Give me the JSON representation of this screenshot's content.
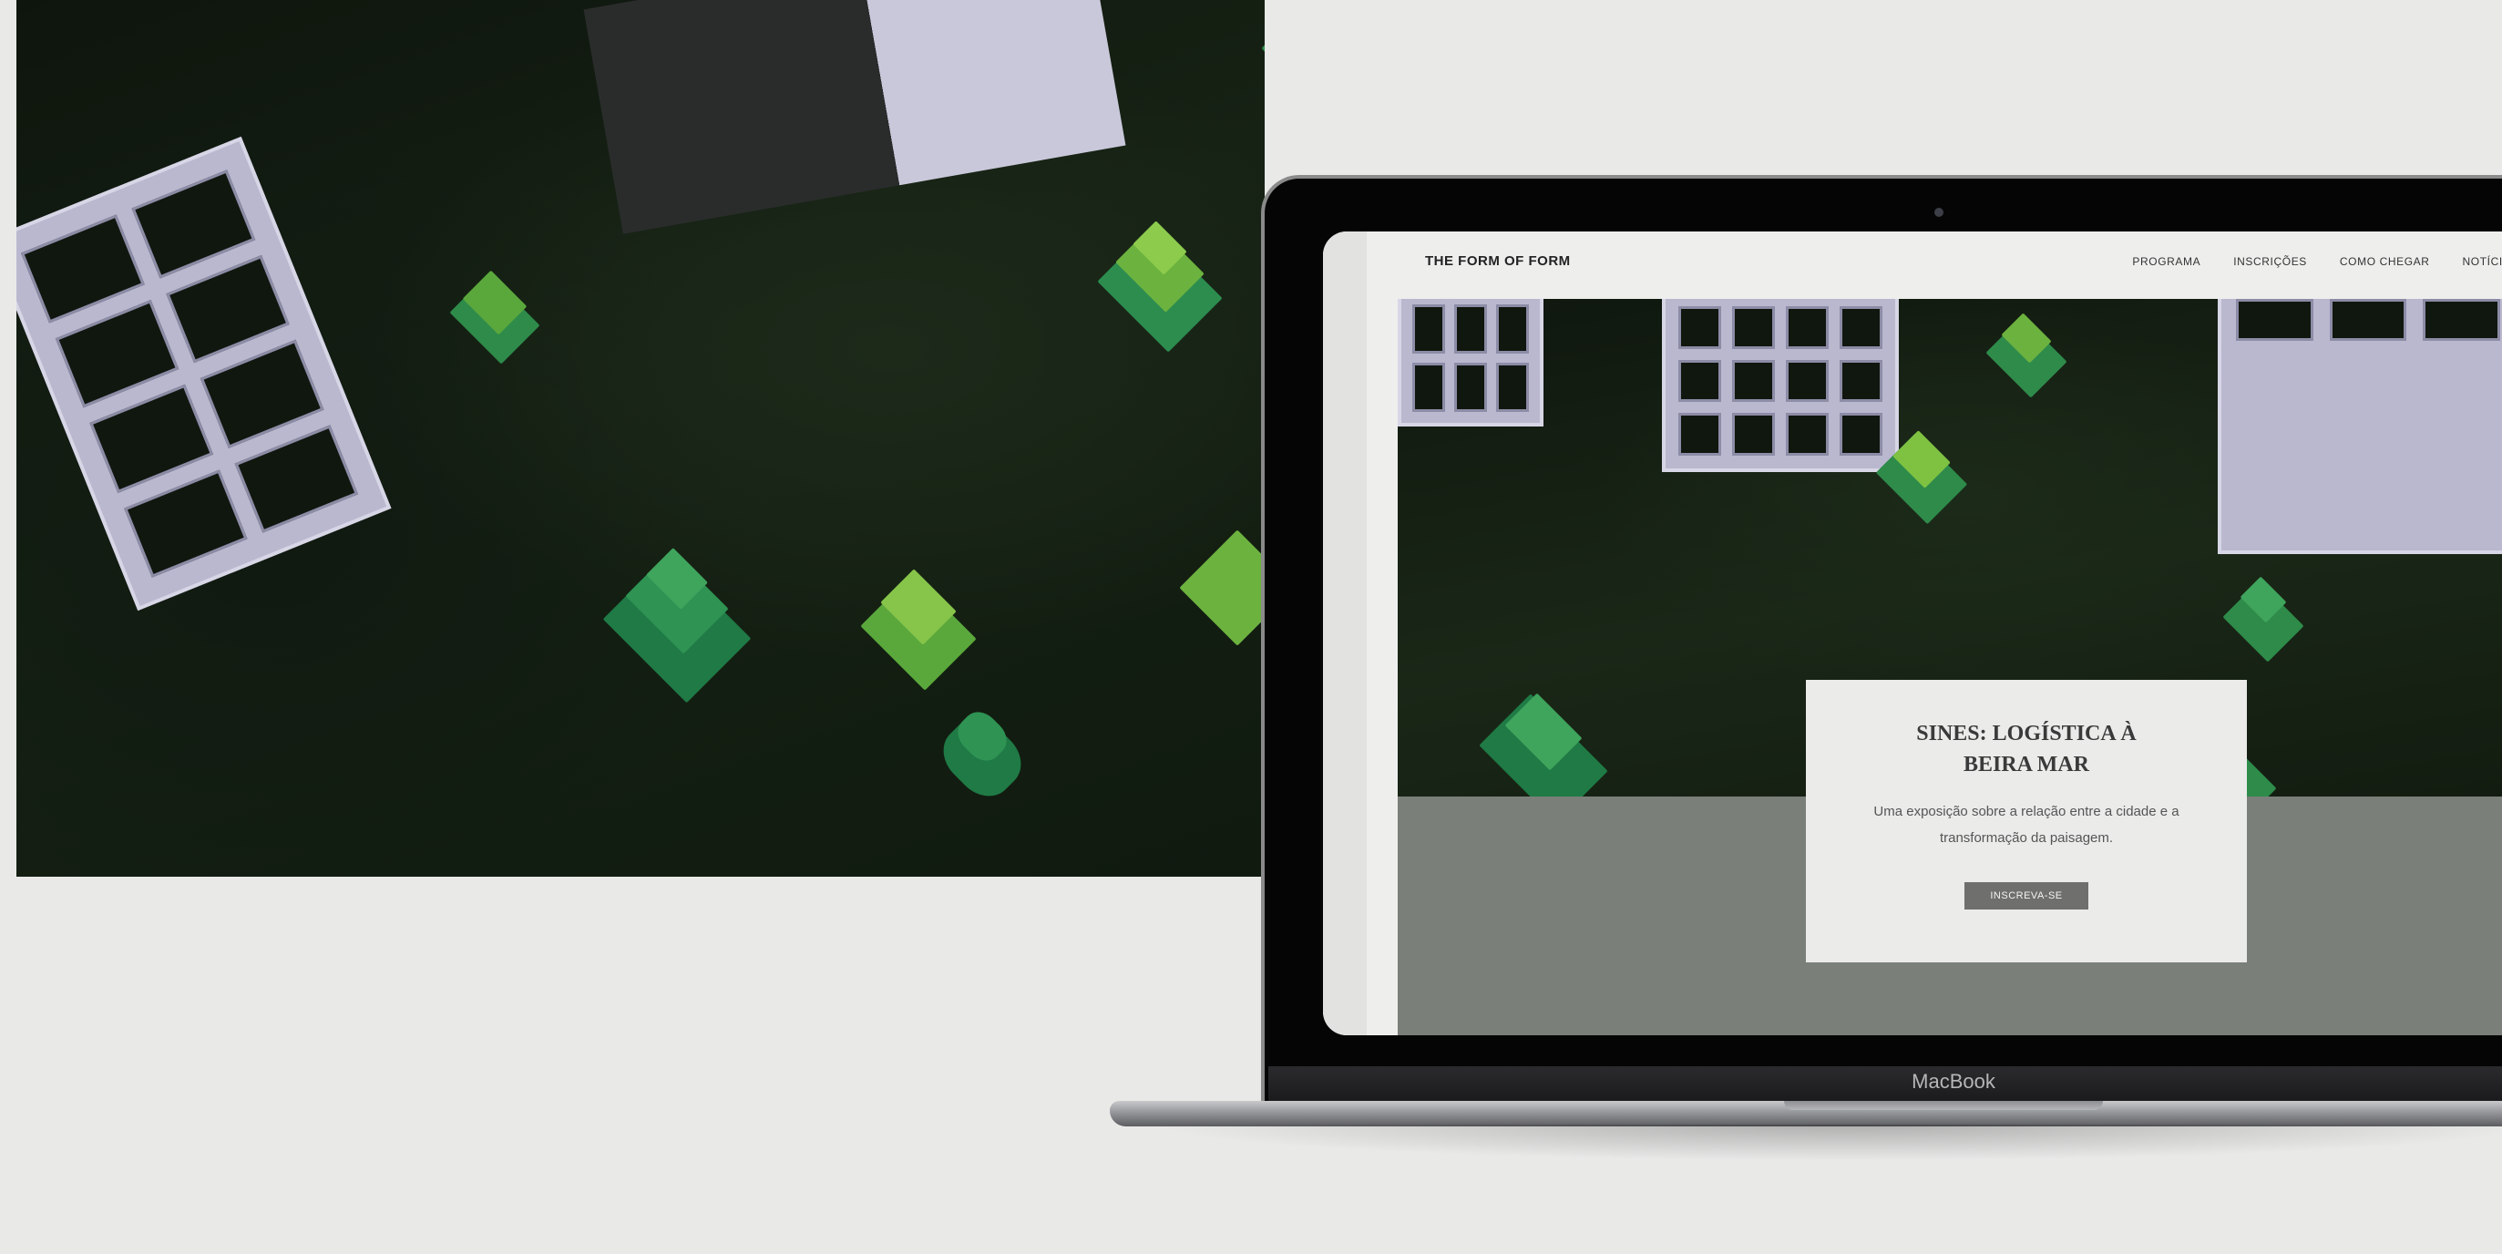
{
  "laptop": {
    "brand": "MacBook"
  },
  "site": {
    "logo": "THE FORM OF FORM",
    "nav": [
      "PROGRAMA",
      "INSCRIÇÕES",
      "COMO CHEGAR",
      "NOTÍCIAS"
    ]
  },
  "hero": {
    "title": "SINES: LOGÍSTICA À BEIRA MAR",
    "description": "Uma exposição sobre a relação entre a cidade e a transformação da paisagem.",
    "cta": "INSCREVA-SE"
  },
  "colors": {
    "background": "#e9e9e8",
    "photo_dark_green": "#162214",
    "tree_green": "#2e8b4a",
    "tree_light_green": "#7fc242",
    "building_lilac": "#b9b8cf",
    "hero_lower": "#7a7f79",
    "button": "#6f6f6e"
  }
}
